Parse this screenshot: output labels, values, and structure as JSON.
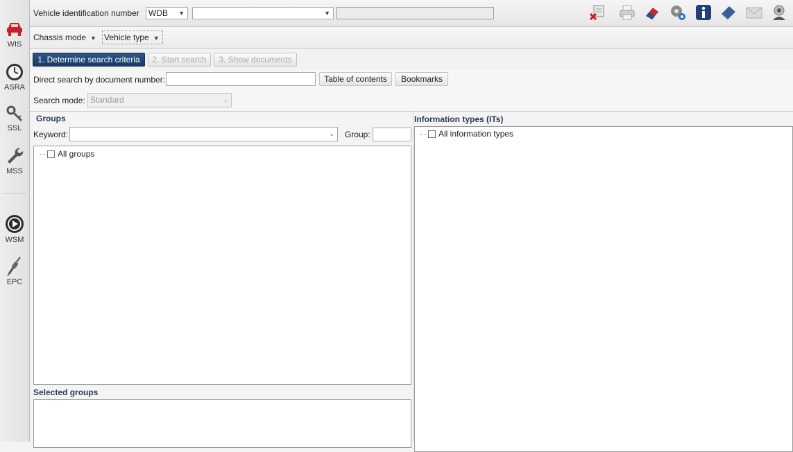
{
  "sidebar": {
    "items": [
      {
        "label": "WIS",
        "icon": "car-icon"
      },
      {
        "label": "ASRA",
        "icon": "clock-icon"
      },
      {
        "label": "SSL",
        "icon": "key-icon"
      },
      {
        "label": "MSS",
        "icon": "wrench-icon"
      },
      {
        "label": "WSM",
        "icon": "play-icon"
      },
      {
        "label": "EPC",
        "icon": "spark-plug-icon"
      }
    ]
  },
  "vin_bar": {
    "label": "Vehicle identification number",
    "prefix_value": "WDB",
    "model_value": "",
    "vin_value": ""
  },
  "toolbar": {
    "icons": [
      "delete-vehicle-icon",
      "print-icon",
      "eraser-icon",
      "settings-gear-icon",
      "info-icon",
      "book-icon",
      "mail-icon",
      "user-help-icon"
    ]
  },
  "mode_bar": {
    "chassis_mode": "Chassis mode",
    "vehicle_type": "Vehicle type"
  },
  "steps": [
    {
      "label": "1. Determine search criteria",
      "state": "active"
    },
    {
      "label": "2. Start search",
      "state": "disabled"
    },
    {
      "label": "3. Show documents",
      "state": "disabled"
    }
  ],
  "direct_search": {
    "label": "Direct search by document number:",
    "value": "",
    "toc_label": "Table of contents",
    "bookmarks_label": "Bookmarks"
  },
  "search_mode": {
    "label": "Search mode:",
    "value": "Standard"
  },
  "groups": {
    "title": "Groups",
    "keyword_label": "Keyword:",
    "keyword_value": "",
    "group_label": "Group:",
    "group_value": "",
    "tree_root": "All groups",
    "selected_title": "Selected groups"
  },
  "info_types": {
    "title": "Information types (ITs)",
    "tree_root": "All information types"
  },
  "colors": {
    "active_step": "#1f4272",
    "section_title": "#2b3a55",
    "wis_red": "#c8202a"
  }
}
